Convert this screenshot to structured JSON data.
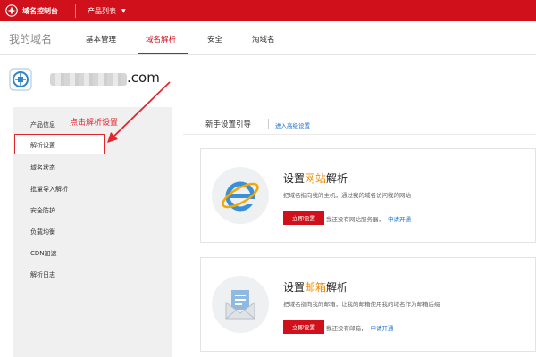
{
  "topbar": {
    "brand": "域名控制台",
    "products_menu": "产品列表"
  },
  "subnav": {
    "title": "我的域名",
    "tabs": [
      "基本管理",
      "域名解析",
      "安全",
      "淘域名"
    ],
    "active_tab": "域名解析"
  },
  "domain": {
    "suffix": ".com"
  },
  "sidebar": {
    "items": [
      "产品信息",
      "解析设置",
      "域名状态",
      "批量导入解析",
      "安全防护",
      "负载均衡",
      "CDN加速",
      "解析日志"
    ],
    "selected": "解析设置"
  },
  "annotation": {
    "text": "点击解析设置"
  },
  "guide": {
    "title": "新手设置引导",
    "advanced_link": "进入高级设置"
  },
  "cards": [
    {
      "title_prefix": "设置",
      "title_highlight": "网站",
      "title_suffix": "解析",
      "desc": "把域名指向我的主机，通过我的域名访问我的网站",
      "button": "立即设置",
      "note": "我还没有网站服务器，",
      "note_link": "申请开通",
      "icon": "ie-browser-icon"
    },
    {
      "title_prefix": "设置",
      "title_highlight": "邮箱",
      "title_suffix": "解析",
      "desc": "把域名指向我的邮箱，让我的邮箱使用我的域名作为邮箱后缀",
      "button": "立即设置",
      "note": "我还没有邮箱，",
      "note_link": "申请开通",
      "icon": "mail-envelope-icon"
    }
  ],
  "colors": {
    "brand_red": "#d0111b",
    "link_blue": "#1a6fd2",
    "highlight_orange": "#f08c00"
  }
}
